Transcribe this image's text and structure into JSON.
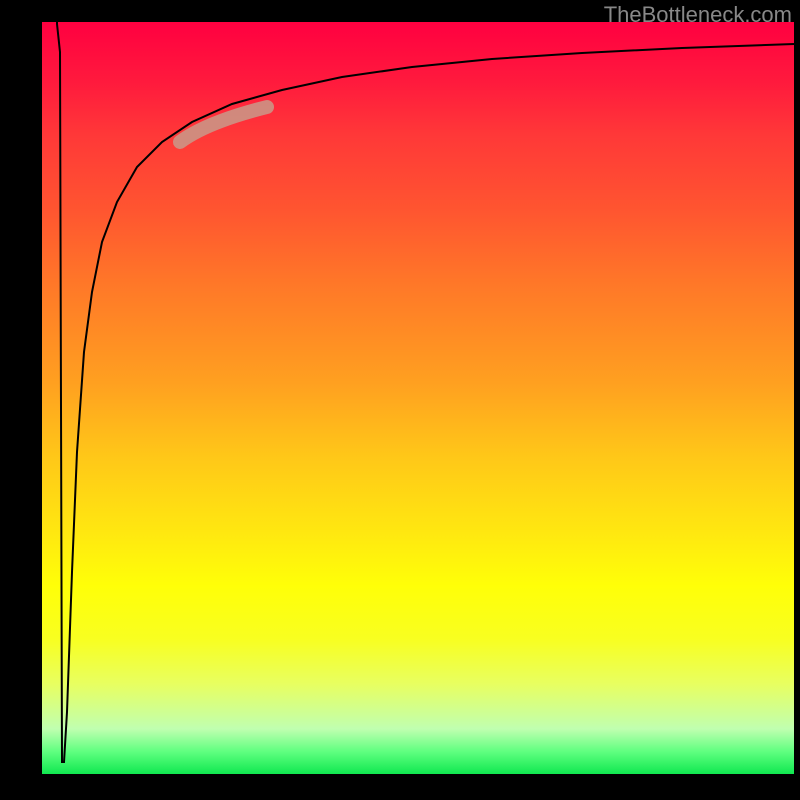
{
  "watermark": "TheBottleneck.com",
  "chart_data": {
    "type": "line",
    "title": "",
    "xlabel": "",
    "ylabel": "",
    "xlim": [
      0,
      100
    ],
    "ylim": [
      0,
      100
    ],
    "grid": false,
    "series": [
      {
        "name": "curve",
        "x": [
          2.5,
          4,
          5,
          6,
          7,
          8,
          10,
          12,
          15,
          18,
          22,
          28,
          35,
          45,
          55,
          65,
          75,
          85,
          95,
          100
        ],
        "y": [
          2,
          98,
          50,
          30,
          40,
          55,
          68,
          75,
          80,
          84,
          86.5,
          88.5,
          90,
          91.5,
          92.5,
          93.2,
          93.8,
          94.2,
          94.6,
          94.8
        ]
      }
    ],
    "highlight": {
      "x_range": [
        18,
        30
      ],
      "description": "highlighted segment on upper curve"
    },
    "colors": {
      "gradient_top": "#ff0040",
      "gradient_bottom": "#10e850",
      "curve": "#000000",
      "highlight": "#c99a8a"
    }
  }
}
